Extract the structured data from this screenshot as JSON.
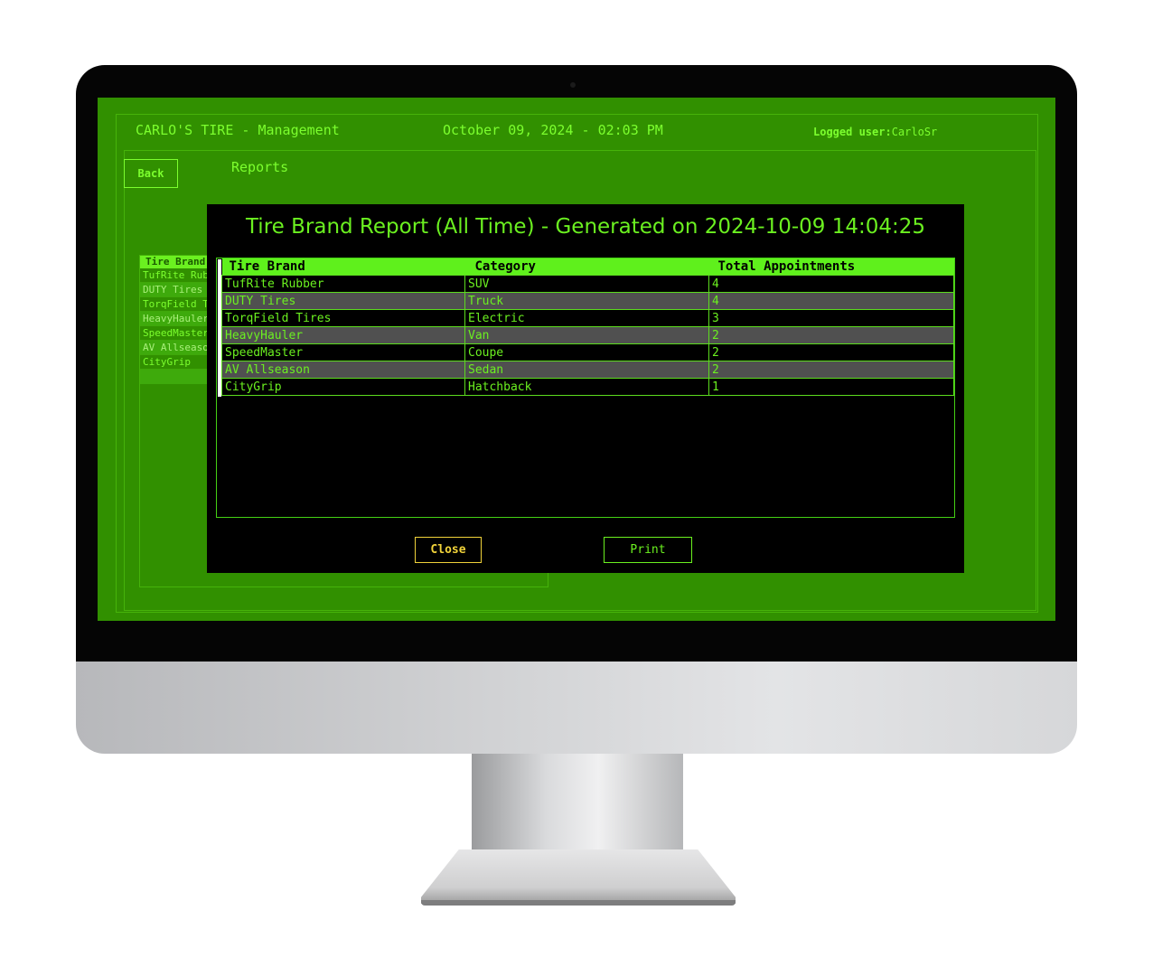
{
  "header": {
    "app_title": "CARLO'S TIRE - Management",
    "datetime": "October 09, 2024 - 02:03 PM",
    "logged_label": "Logged user:",
    "logged_user": "CarloSr"
  },
  "nav": {
    "back_label": "Back",
    "page_title": "Reports"
  },
  "background_list": {
    "header": "Tire Brand",
    "items": [
      "TufRite Rubber",
      "DUTY Tires",
      "TorqField Tires",
      "HeavyHauler",
      "SpeedMaster",
      "AV Allseason",
      "CityGrip"
    ]
  },
  "report": {
    "title": "Tire Brand Report (All Time) - Generated on 2024-10-09 14:04:25",
    "columns": [
      "Tire Brand",
      "Category",
      "Total Appointments"
    ],
    "rows": [
      [
        "TufRite Rubber",
        "SUV",
        "4"
      ],
      [
        "DUTY Tires",
        "Truck",
        "4"
      ],
      [
        "TorqField Tires",
        "Electric",
        "3"
      ],
      [
        "HeavyHauler",
        "Van",
        "2"
      ],
      [
        "SpeedMaster",
        "Coupe",
        "2"
      ],
      [
        "AV Allseason",
        "Sedan",
        "2"
      ],
      [
        "CityGrip",
        "Hatchback",
        "1"
      ]
    ],
    "close_label": "Close",
    "print_label": "Print"
  },
  "colors": {
    "screen_bg": "#319000",
    "accent_green": "#6bf020",
    "dialog_bg": "#000000",
    "close_button": "#f0d23a",
    "alt_row": "#505050"
  }
}
